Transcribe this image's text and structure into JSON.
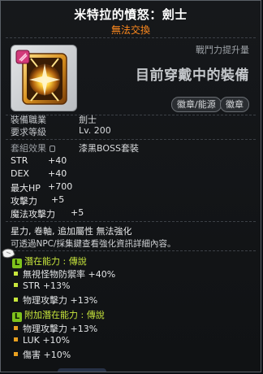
{
  "header": {
    "title": "米特拉的憤怒：劍士",
    "subtitle": "無法交換"
  },
  "combat_power": {
    "label": "戰鬥力提升量",
    "status": "目前穿戴中的裝備"
  },
  "tags": [
    "徽章/能源",
    "徽章"
  ],
  "requirements": {
    "job_label": "裝備職業",
    "job_value": "劍士",
    "level_label": "要求等級",
    "level_value": "Lv. 200"
  },
  "set_effect": {
    "label": "套組效果",
    "value": "漆黑BOSS套裝"
  },
  "stats": [
    {
      "name": "STR",
      "value": "+40"
    },
    {
      "name": "DEX",
      "value": "+40"
    },
    {
      "name": "最大HP",
      "value": "+700"
    },
    {
      "name": "攻擊力",
      "value": "+5"
    },
    {
      "name": "魔法攻擊力",
      "value": "+5"
    }
  ],
  "description": {
    "line1": "星力, 卷軸, 追加屬性 無法強化",
    "line2": "可透過NPC/採集鍵查看強化資訊詳細內容。"
  },
  "potential": {
    "badge": "L",
    "label": "潛在能力 : 傳說",
    "lines": [
      "無視怪物防禦率 +40%",
      "STR +13%",
      "物理攻擊力 +13%"
    ]
  },
  "bonus_potential": {
    "badge": "L",
    "label": "附加潛在能力 : 傳說",
    "lines": [
      "物理攻擊力 +13%",
      "LUK +10%",
      "傷害 +10%"
    ]
  },
  "colors": {
    "title": "#ffffff",
    "untradeable": "#ff8a1e",
    "legendary": "#c8e63c",
    "badge_legendary": "#7fc31c",
    "bonus_bullet": "#e8a020"
  },
  "icons": {
    "item": "golden-emblem-icon",
    "lock": "lock-icon",
    "cursor": "mouse-cursor-icon"
  }
}
